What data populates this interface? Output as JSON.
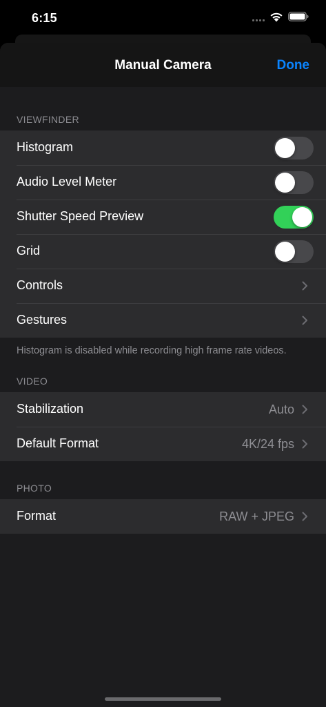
{
  "status_bar": {
    "time": "6:15",
    "signal_icon": "cellular-signal-icon",
    "wifi_icon": "wifi-icon",
    "battery_icon": "battery-icon"
  },
  "nav": {
    "title": "Manual Camera",
    "done_label": "Done"
  },
  "viewfinder": {
    "header": "VIEWFINDER",
    "rows": [
      {
        "label": "Histogram",
        "type": "toggle",
        "on": false
      },
      {
        "label": "Audio Level Meter",
        "type": "toggle",
        "on": false
      },
      {
        "label": "Shutter Speed Preview",
        "type": "toggle",
        "on": true
      },
      {
        "label": "Grid",
        "type": "toggle",
        "on": false
      },
      {
        "label": "Controls",
        "type": "disclosure"
      },
      {
        "label": "Gestures",
        "type": "disclosure"
      }
    ],
    "footer": "Histogram is disabled while recording high frame rate videos."
  },
  "video": {
    "header": "VIDEO",
    "rows": [
      {
        "label": "Stabilization",
        "value": "Auto",
        "type": "disclosure"
      },
      {
        "label": "Default Format",
        "value": "4K/24 fps",
        "type": "disclosure"
      }
    ]
  },
  "photo": {
    "header": "PHOTO",
    "rows": [
      {
        "label": "Format",
        "value": "RAW + JPEG",
        "type": "disclosure"
      }
    ]
  },
  "colors": {
    "accent": "#0a84ff",
    "toggle_on": "#32d158",
    "toggle_off": "#48484b",
    "cell_background": "#2c2c2e",
    "sheet_background": "#1c1c1e"
  }
}
